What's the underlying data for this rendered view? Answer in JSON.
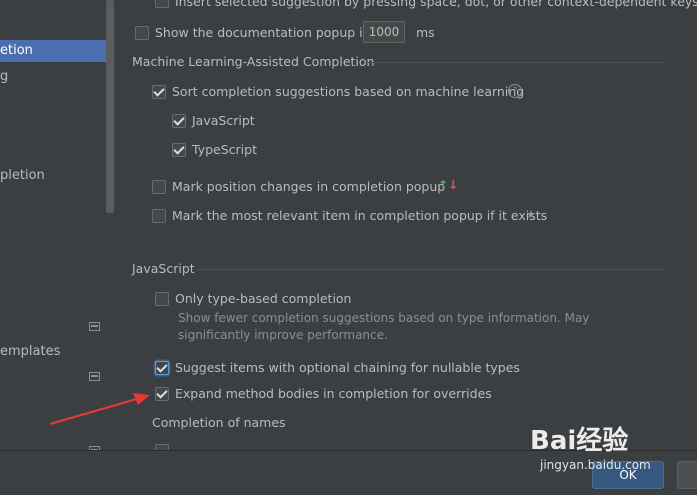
{
  "sidebar": {
    "items": [
      {
        "label": "etion",
        "selected": true
      },
      {
        "label": "g",
        "selected": false
      },
      {
        "label": "pletion",
        "selected": false
      },
      {
        "label": "emplates",
        "selected": false
      }
    ]
  },
  "top": {
    "cut_label": "Insert selected suggestion by pressing space, dot, or other context-dependent keys",
    "doc_popup_label": "Show the documentation popup in",
    "doc_popup_value": "1000",
    "doc_popup_unit": "ms"
  },
  "ml": {
    "section_title": "Machine Learning-Assisted Completion",
    "sort_label": "Sort completion suggestions based on machine learning",
    "javascript_label": "JavaScript",
    "typescript_label": "TypeScript",
    "mark_pos_label": "Mark position changes in completion popup",
    "mark_relevant_label": "Mark the most relevant item in completion popup if it exists"
  },
  "js": {
    "section_title": "JavaScript",
    "only_type_label": "Only type-based completion",
    "only_type_hint": "Show fewer completion suggestions based on type information. May significantly improve performance.",
    "optional_chaining_label": "Suggest items with optional chaining for nullable types",
    "expand_method_label": "Expand method bodies in completion for overrides",
    "completion_names_title": "Completion of names"
  },
  "footer": {
    "ok_label": "OK"
  },
  "watermark": {
    "brand": "Bai经验",
    "url": "jingyan.baidu.com"
  },
  "colors": {
    "accent": "#4b6eaf",
    "annotation_arrow": "#e53935",
    "arrow_up": "#59a869",
    "arrow_down": "#e05555"
  }
}
